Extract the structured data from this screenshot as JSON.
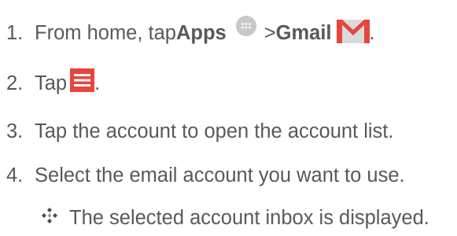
{
  "steps": [
    {
      "number": "1.",
      "text_before": "From home, tap ",
      "apps_label": "Apps",
      "separator": " > ",
      "gmail_label": "Gmail",
      "end": "."
    },
    {
      "number": "2.",
      "text_before": "Tap ",
      "end": "."
    },
    {
      "number": "3.",
      "text": "Tap the account to open the account list."
    },
    {
      "number": "4.",
      "text": "Select the email account you want to use."
    }
  ],
  "result": {
    "text": "The selected account inbox is displayed."
  },
  "icons": {
    "apps": "apps-grid-icon",
    "gmail": "gmail-icon",
    "menu": "menu-icon",
    "result_bullet": "diamond-bullet-icon"
  },
  "colors": {
    "text": "#595959",
    "apps_icon": "#c8c8c8",
    "gmail_red": "#e8453c",
    "gmail_grey": "#dadada",
    "menu_red": "#e8453c"
  }
}
